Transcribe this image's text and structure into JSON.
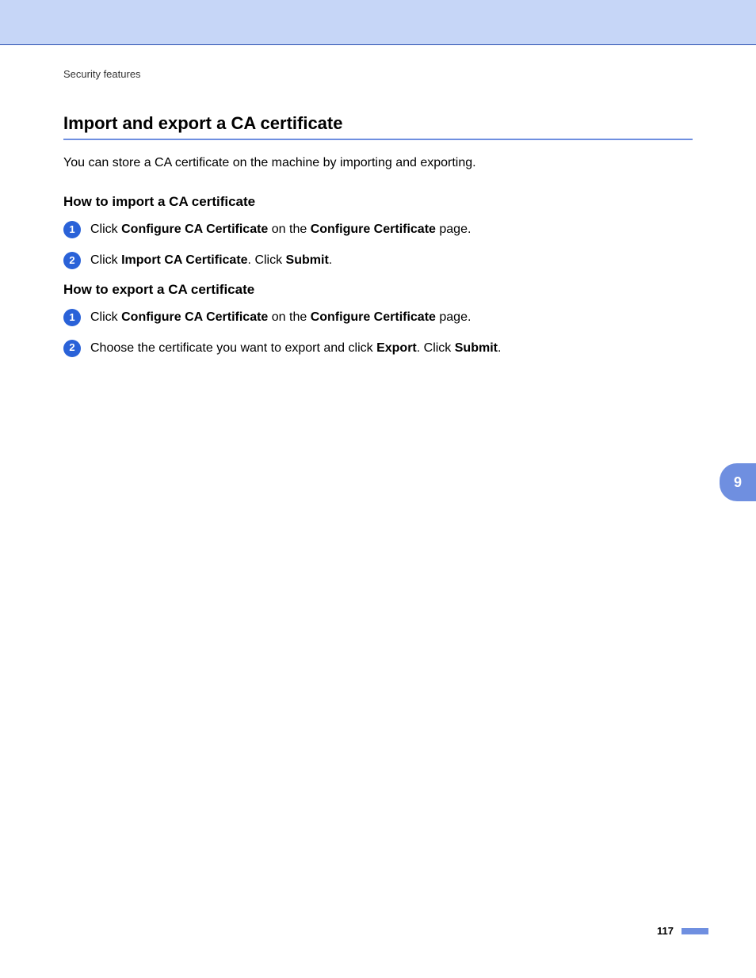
{
  "header": {
    "breadcrumb": "Security features"
  },
  "main": {
    "title": "Import and export a CA certificate",
    "intro": "You can store a CA certificate on the machine by importing and exporting.",
    "sections": [
      {
        "heading": "How to import a CA certificate",
        "steps": [
          {
            "num": "1",
            "parts": [
              {
                "t": "Click ",
                "b": false
              },
              {
                "t": "Configure CA Certificate",
                "b": true
              },
              {
                "t": " on the ",
                "b": false
              },
              {
                "t": "Configure Certificate",
                "b": true
              },
              {
                "t": " page.",
                "b": false
              }
            ]
          },
          {
            "num": "2",
            "parts": [
              {
                "t": "Click ",
                "b": false
              },
              {
                "t": "Import CA Certificate",
                "b": true
              },
              {
                "t": ". Click ",
                "b": false
              },
              {
                "t": "Submit",
                "b": true
              },
              {
                "t": ".",
                "b": false
              }
            ]
          }
        ]
      },
      {
        "heading": "How to export a CA certificate",
        "steps": [
          {
            "num": "1",
            "parts": [
              {
                "t": "Click ",
                "b": false
              },
              {
                "t": "Configure CA Certificate",
                "b": true
              },
              {
                "t": " on the ",
                "b": false
              },
              {
                "t": "Configure Certificate",
                "b": true
              },
              {
                "t": " page.",
                "b": false
              }
            ]
          },
          {
            "num": "2",
            "parts": [
              {
                "t": "Choose the certificate you want to export and click ",
                "b": false
              },
              {
                "t": "Export",
                "b": true
              },
              {
                "t": ". Click ",
                "b": false
              },
              {
                "t": "Submit",
                "b": true
              },
              {
                "t": ".",
                "b": false
              }
            ]
          }
        ]
      }
    ]
  },
  "chapter_tab": "9",
  "page_number": "117"
}
